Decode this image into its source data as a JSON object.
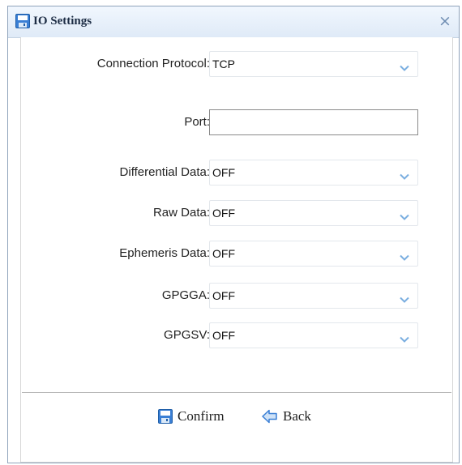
{
  "dialog": {
    "title": "IO Settings",
    "close_glyph": "×"
  },
  "fields": {
    "connection_protocol": {
      "label": "Connection Protocol:",
      "value": "TCP"
    },
    "port": {
      "label": "Port:",
      "value": ""
    },
    "differential_data": {
      "label": "Differential Data:",
      "value": "OFF"
    },
    "raw_data": {
      "label": "Raw Data:",
      "value": "OFF"
    },
    "ephemeris_data": {
      "label": "Ephemeris Data:",
      "value": "OFF"
    },
    "gpgga": {
      "label": "GPGGA:",
      "value": "OFF"
    },
    "gpgsv": {
      "label": "GPGSV:",
      "value": "OFF"
    }
  },
  "buttons": {
    "confirm_label": "Confirm",
    "back_label": "Back"
  },
  "icons": {
    "title": "save-icon",
    "select_arrow": "chevron-down-icon",
    "confirm": "save-icon",
    "back": "back-arrow-icon"
  },
  "colors": {
    "accent": "#3a7fd5",
    "title_text": "#1c2c44",
    "arrow": "#7aaee0"
  }
}
